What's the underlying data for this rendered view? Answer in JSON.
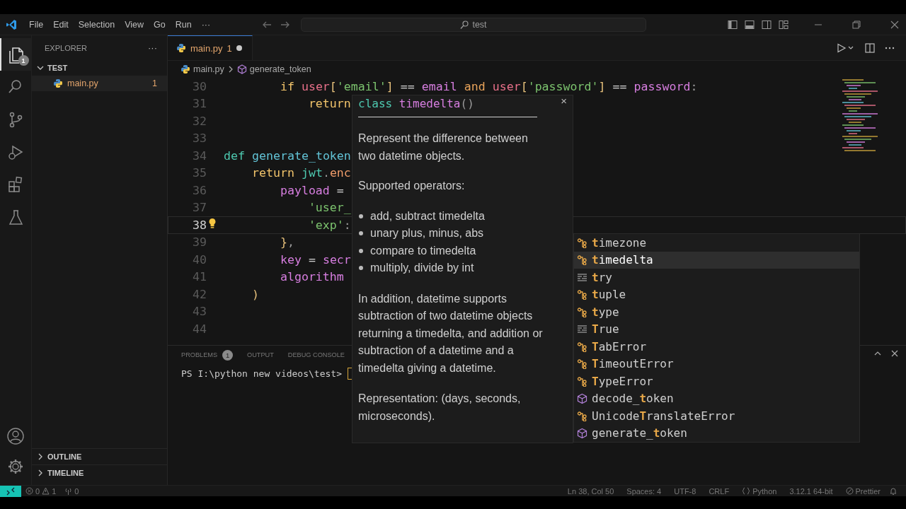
{
  "titlebar": {
    "menus": [
      "File",
      "Edit",
      "Selection",
      "View",
      "Go",
      "Run",
      "···"
    ],
    "search": "test"
  },
  "activity_bar": {
    "items": [
      {
        "kind": "explorer",
        "selected": true,
        "badge": "1"
      },
      {
        "kind": "search",
        "selected": false
      },
      {
        "kind": "source-control",
        "selected": false
      },
      {
        "kind": "run-debug",
        "selected": false
      },
      {
        "kind": "extensions",
        "selected": false
      },
      {
        "kind": "testing",
        "selected": false
      }
    ]
  },
  "sidebar": {
    "title": "EXPLORER",
    "more": "···",
    "folder": {
      "name": "TEST",
      "expanded": true,
      "files": [
        {
          "name": "main.py",
          "problems": "1"
        }
      ]
    },
    "sections": [
      {
        "name": "OUTLINE",
        "expanded": false
      },
      {
        "name": "TIMELINE",
        "expanded": false
      }
    ]
  },
  "editor": {
    "tabs": [
      {
        "label": "main.py",
        "problems": "1",
        "modified": true,
        "selected": true
      }
    ],
    "breadcrumb": [
      "main.py",
      "generate_token"
    ],
    "lines": [
      {
        "number": "30",
        "current": false,
        "lightbulb": false,
        "tokens": [
          {
            "text": "        if",
            "kind": "kw"
          },
          {
            "text": " user",
            "kind": "var"
          },
          {
            "text": "[",
            "kind": "br"
          },
          {
            "text": "'email'",
            "kind": "str"
          },
          {
            "text": "]",
            "kind": "br"
          },
          {
            "text": " == ",
            "kind": "op"
          },
          {
            "text": "email",
            "kind": "param"
          },
          {
            "text": " and ",
            "kind": "and"
          },
          {
            "text": "user",
            "kind": "var"
          },
          {
            "text": "[",
            "kind": "br"
          },
          {
            "text": "'password'",
            "kind": "str"
          },
          {
            "text": "]",
            "kind": "br"
          },
          {
            "text": " == ",
            "kind": "op"
          },
          {
            "text": "password",
            "kind": "param"
          },
          {
            "text": ":",
            "kind": "punc"
          }
        ]
      },
      {
        "number": "31",
        "current": false,
        "lightbulb": false,
        "tokens": [
          {
            "text": "            return",
            "kind": "kw"
          }
        ]
      },
      {
        "number": "32",
        "current": false,
        "lightbulb": false
      },
      {
        "number": "33",
        "current": false,
        "lightbulb": false
      },
      {
        "number": "34",
        "current": false,
        "lightbulb": false,
        "tokens": [
          {
            "text": "def",
            "kind": "def"
          },
          {
            "text": " generate_token",
            "kind": "fn"
          }
        ]
      },
      {
        "number": "35",
        "current": false,
        "lightbulb": false,
        "tokens": [
          {
            "text": "    return",
            "kind": "kw"
          },
          {
            "text": " jwt",
            "kind": "mod"
          },
          {
            "text": ".",
            "kind": "punc"
          },
          {
            "text": "enc",
            "kind": "method"
          }
        ]
      },
      {
        "number": "36",
        "current": false,
        "lightbulb": false,
        "tokens": [
          {
            "text": "        payload",
            "kind": "param"
          },
          {
            "text": " =",
            "kind": "op"
          }
        ]
      },
      {
        "number": "37",
        "current": false,
        "lightbulb": false,
        "tokens": [
          {
            "text": "            'user_",
            "kind": "str"
          }
        ]
      },
      {
        "number": "38",
        "current": true,
        "lightbulb": true,
        "tokens": [
          {
            "text": "            'exp'",
            "kind": "str"
          },
          {
            "text": ":",
            "kind": "punc"
          }
        ]
      },
      {
        "number": "39",
        "current": false,
        "lightbulb": false,
        "tokens": [
          {
            "text": "        }",
            "kind": "br"
          },
          {
            "text": ",",
            "kind": "punc"
          }
        ]
      },
      {
        "number": "40",
        "current": false,
        "lightbulb": false,
        "tokens": [
          {
            "text": "        key",
            "kind": "param"
          },
          {
            "text": " = ",
            "kind": "op"
          },
          {
            "text": "secr",
            "kind": "param"
          }
        ]
      },
      {
        "number": "41",
        "current": false,
        "lightbulb": false,
        "tokens": [
          {
            "text": "        algorithm",
            "kind": "param"
          }
        ]
      },
      {
        "number": "42",
        "current": false,
        "lightbulb": false,
        "tokens": [
          {
            "text": "    )",
            "kind": "br"
          }
        ]
      },
      {
        "number": "43",
        "current": false,
        "lightbulb": false
      },
      {
        "number": "44",
        "current": false,
        "lightbulb": false
      }
    ]
  },
  "hover": {
    "signature": [
      {
        "text": "class",
        "kind": "def"
      },
      {
        "text": " timedelta",
        "kind": "param"
      },
      {
        "text": "()",
        "kind": "punc"
      }
    ],
    "close": "×",
    "intro": "Represent the difference between two datetime objects.",
    "operators_heading": "Supported operators:",
    "operators": [
      "add, subtract timedelta",
      "unary plus, minus, abs",
      "compare to timedelta",
      "multiply, divide by int"
    ],
    "paragraphs": [
      "In addition, datetime supports subtraction of two datetime objects returning a timedelta, and addition or subtraction of a datetime and a timedelta giving a datetime.",
      "Representation: (days, seconds, microseconds)."
    ]
  },
  "suggestions": [
    {
      "label": "**t**imezone",
      "kind": "class",
      "selected": false
    },
    {
      "label": "**t**imedelta",
      "kind": "class",
      "selected": true
    },
    {
      "label": "**t**ry",
      "kind": "keyword",
      "selected": false
    },
    {
      "label": "**t**uple",
      "kind": "class",
      "selected": false
    },
    {
      "label": "**t**ype",
      "kind": "class",
      "selected": false
    },
    {
      "label": "**T**rue",
      "kind": "keyword",
      "selected": false
    },
    {
      "label": "**T**abError",
      "kind": "class",
      "selected": false
    },
    {
      "label": "**T**imeoutError",
      "kind": "class",
      "selected": false
    },
    {
      "label": "**T**ypeError",
      "kind": "class",
      "selected": false
    },
    {
      "label": "decode_**t**oken",
      "kind": "function",
      "selected": false
    },
    {
      "label": "Unicode**T**ranslateError",
      "kind": "class",
      "selected": false
    },
    {
      "label": "generate_**t**oken",
      "kind": "function",
      "selected": false
    }
  ],
  "panel": {
    "tabs": [
      {
        "label": "PROBLEMS",
        "badge": "1",
        "selected": false
      },
      {
        "label": "OUTPUT",
        "selected": false
      },
      {
        "label": "DEBUG CONSOLE",
        "selected": false
      }
    ],
    "terminal_prompt": "PS I:\\python new videos\\test>"
  },
  "status_bar": {
    "errors": "0",
    "warnings": "1",
    "ports": "0",
    "right": [
      {
        "kind": "text",
        "label": "Ln 38, Col 50"
      },
      {
        "kind": "text",
        "label": "Spaces: 4"
      },
      {
        "kind": "text",
        "label": "UTF-8"
      },
      {
        "kind": "text",
        "label": "CRLF"
      },
      {
        "kind": "language",
        "label": "Python"
      },
      {
        "kind": "text",
        "label": "3.12.1 64-bit"
      },
      {
        "kind": "prettier",
        "label": "Prettier"
      },
      {
        "kind": "bell"
      }
    ]
  }
}
